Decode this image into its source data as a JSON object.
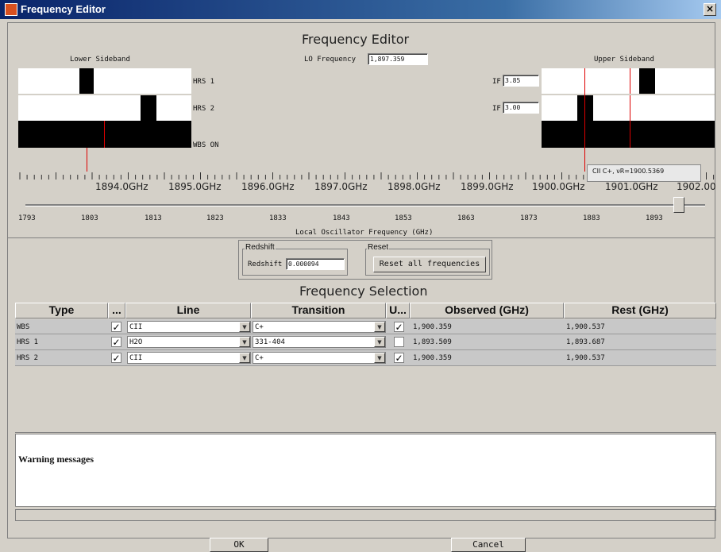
{
  "window": {
    "title": "Frequency Editor",
    "close_glyph": "×"
  },
  "editor": {
    "heading": "Frequency Editor",
    "lower_sideband_label": "Lower Sideband",
    "upper_sideband_label": "Upper Sideband",
    "lo_frequency_label": "LO Frequency",
    "lo_frequency_value": "1,897.359",
    "bands": [
      "HRS 1",
      "HRS 2",
      "WBS ON"
    ],
    "if_label": "IF",
    "if_values": [
      "3.85",
      "3.00"
    ],
    "freq_axis_labels": [
      "1894.0GHz",
      "1895.0GHz",
      "1896.0GHz",
      "1897.0GHz",
      "1898.0GHz",
      "1899.0GHz",
      "1900.0GHz",
      "1901.0GHz",
      "1902.00"
    ],
    "tooltip": "CII C+, νR=1900.5369",
    "slider_labels": [
      "1793",
      "1803",
      "1813",
      "1823",
      "1833",
      "1843",
      "1853",
      "1863",
      "1873",
      "1883",
      "1893"
    ],
    "slider_caption": "Local Oscillator Frequency (GHz)",
    "slider_value": 1897.359
  },
  "redshift": {
    "group_label": "Redshift",
    "field_label": "Redshift",
    "value": "0.000094"
  },
  "reset": {
    "group_label": "Reset",
    "button": "Reset all frequencies"
  },
  "selection": {
    "heading": "Frequency Selection",
    "columns": [
      "Type",
      "...",
      "Line",
      "Transition",
      "U...",
      "Observed (GHz)",
      "Rest (GHz)"
    ],
    "rows": [
      {
        "type": "WBS",
        "checked": true,
        "line": "CII",
        "transition": "C+",
        "used": true,
        "observed": "1,900.359",
        "rest": "1,900.537"
      },
      {
        "type": "HRS 1",
        "checked": true,
        "line": "H2O",
        "transition": "331-404",
        "used": false,
        "observed": "1,893.509",
        "rest": "1,893.687"
      },
      {
        "type": "HRS 2",
        "checked": true,
        "line": "CII",
        "transition": "C+",
        "used": true,
        "observed": "1,900.359",
        "rest": "1,900.537"
      }
    ]
  },
  "warnings": {
    "title": "Warning messages"
  },
  "buttons": {
    "ok": "OK",
    "cancel": "Cancel"
  },
  "colors": {
    "titlebar": "#0a246a",
    "window_bg": "#d4d0c8",
    "marker": "#dd0000"
  }
}
